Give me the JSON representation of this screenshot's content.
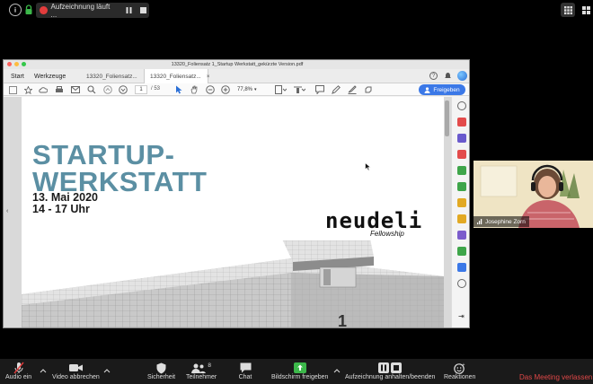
{
  "topbar": {
    "recording_label": "Aufzeichnung läuft ...",
    "icons": [
      "info-icon",
      "lock-icon",
      "record-icon",
      "pause-icon",
      "stop-icon",
      "grid-icon",
      "view-icon"
    ]
  },
  "acrobat": {
    "window_title": "13320_Foliensatz 1_Startup Werkstatt_gekürzte Version.pdf",
    "nav": {
      "start": "Start",
      "tools": "Werkzeuge"
    },
    "tabs": [
      {
        "label": "13320_Foliensatz..."
      },
      {
        "label": "13320_Foliensatz..."
      }
    ],
    "toolbar": {
      "page_current": "1",
      "page_total": "/ 53",
      "zoom": "77,8%",
      "share_label": "Freigeben"
    }
  },
  "slide": {
    "title_line1": "STARTUP-",
    "title_line2": "WERKSTATT",
    "date": "13. Mai 2020",
    "time": "14 - 17 Uhr",
    "brand": "neudeli",
    "brand_sub": "Fellowship",
    "box_number": "1"
  },
  "participant": {
    "name": "Josephine Zorn"
  },
  "controls": {
    "audio": "Audio ein",
    "video": "Video abbrechen",
    "security": "Sicherheit",
    "participants": "Teilnehmer",
    "participants_count": "8",
    "chat": "Chat",
    "share": "Bildschirm freigeben",
    "record": "Aufzeichnung anhalten/beenden",
    "reactions": "Reaktionen",
    "leave": "Das Meeting verlassen"
  },
  "colors": {
    "accent_title": "#5b8fa3",
    "record_red": "#e23c3c",
    "share_green": "#3cb84a",
    "leave_red": "#e04848",
    "acrobat_blue": "#3b78e7"
  }
}
